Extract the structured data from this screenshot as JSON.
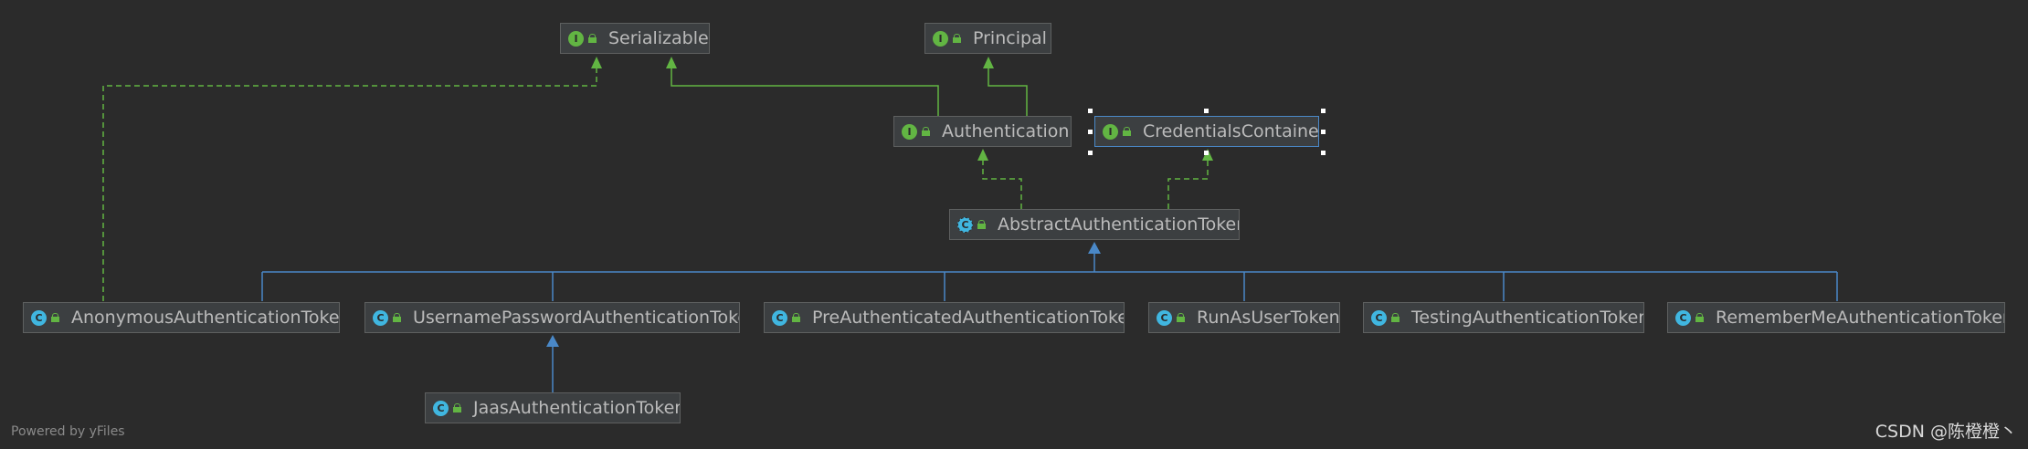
{
  "diagram": {
    "title": "",
    "nodes": {
      "serializable": {
        "label": "Serializable",
        "kind": "interface",
        "badge": "I"
      },
      "principal": {
        "label": "Principal",
        "kind": "interface",
        "badge": "I"
      },
      "authentication": {
        "label": "Authentication",
        "kind": "interface",
        "badge": "I"
      },
      "credentials_container": {
        "label": "CredentialsContainer",
        "kind": "interface",
        "badge": "I",
        "selected": true
      },
      "abstract_token": {
        "label": "AbstractAuthenticationToken",
        "kind": "abstract class",
        "badge": "C"
      },
      "anonymous_token": {
        "label": "AnonymousAuthenticationToken",
        "kind": "class",
        "badge": "C"
      },
      "username_password_token": {
        "label": "UsernamePasswordAuthenticationToken",
        "kind": "class",
        "badge": "C"
      },
      "preauthenticated_token": {
        "label": "PreAuthenticatedAuthenticationToken",
        "kind": "class",
        "badge": "C"
      },
      "runas_token": {
        "label": "RunAsUserToken",
        "kind": "class",
        "badge": "C"
      },
      "testing_token": {
        "label": "TestingAuthenticationToken",
        "kind": "class",
        "badge": "C"
      },
      "rememberme_token": {
        "label": "RememberMeAuthenticationToken",
        "kind": "class",
        "badge": "C"
      },
      "jaas_token": {
        "label": "JaasAuthenticationToken",
        "kind": "class",
        "badge": "C"
      }
    },
    "edges": [
      {
        "from": "authentication",
        "to": "serializable",
        "type": "extends"
      },
      {
        "from": "authentication",
        "to": "principal",
        "type": "extends"
      },
      {
        "from": "abstract_token",
        "to": "authentication",
        "type": "implements"
      },
      {
        "from": "abstract_token",
        "to": "credentials_container",
        "type": "implements"
      },
      {
        "from": "anonymous_token",
        "to": "serializable",
        "type": "implements"
      },
      {
        "from": "anonymous_token",
        "to": "abstract_token",
        "type": "extends"
      },
      {
        "from": "username_password_token",
        "to": "abstract_token",
        "type": "extends"
      },
      {
        "from": "preauthenticated_token",
        "to": "abstract_token",
        "type": "extends"
      },
      {
        "from": "runas_token",
        "to": "abstract_token",
        "type": "extends"
      },
      {
        "from": "testing_token",
        "to": "abstract_token",
        "type": "extends"
      },
      {
        "from": "rememberme_token",
        "to": "abstract_token",
        "type": "extends"
      },
      {
        "from": "jaas_token",
        "to": "username_password_token",
        "type": "extends"
      }
    ],
    "colors": {
      "background": "#2b2b2b",
      "interface_edge": "#62b543",
      "class_edge": "#4a88c7",
      "interface_badge": "#62b543",
      "class_badge": "#40b6e0"
    }
  },
  "footer": {
    "powered_by": "Powered by yFiles",
    "watermark": "CSDN @陈橙橙丶"
  }
}
